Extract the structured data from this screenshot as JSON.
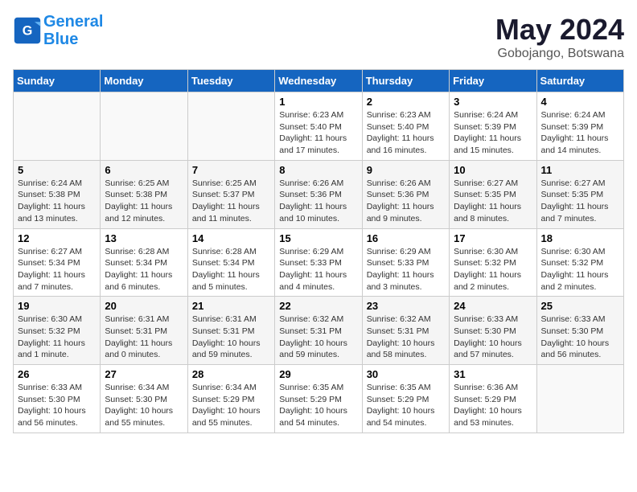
{
  "header": {
    "logo_line1": "General",
    "logo_line2": "Blue",
    "month_title": "May 2024",
    "subtitle": "Gobojango, Botswana"
  },
  "days_of_week": [
    "Sunday",
    "Monday",
    "Tuesday",
    "Wednesday",
    "Thursday",
    "Friday",
    "Saturday"
  ],
  "weeks": [
    [
      {
        "day": "",
        "info": ""
      },
      {
        "day": "",
        "info": ""
      },
      {
        "day": "",
        "info": ""
      },
      {
        "day": "1",
        "info": "Sunrise: 6:23 AM\nSunset: 5:40 PM\nDaylight: 11 hours and 17 minutes."
      },
      {
        "day": "2",
        "info": "Sunrise: 6:23 AM\nSunset: 5:40 PM\nDaylight: 11 hours and 16 minutes."
      },
      {
        "day": "3",
        "info": "Sunrise: 6:24 AM\nSunset: 5:39 PM\nDaylight: 11 hours and 15 minutes."
      },
      {
        "day": "4",
        "info": "Sunrise: 6:24 AM\nSunset: 5:39 PM\nDaylight: 11 hours and 14 minutes."
      }
    ],
    [
      {
        "day": "5",
        "info": "Sunrise: 6:24 AM\nSunset: 5:38 PM\nDaylight: 11 hours and 13 minutes."
      },
      {
        "day": "6",
        "info": "Sunrise: 6:25 AM\nSunset: 5:38 PM\nDaylight: 11 hours and 12 minutes."
      },
      {
        "day": "7",
        "info": "Sunrise: 6:25 AM\nSunset: 5:37 PM\nDaylight: 11 hours and 11 minutes."
      },
      {
        "day": "8",
        "info": "Sunrise: 6:26 AM\nSunset: 5:36 PM\nDaylight: 11 hours and 10 minutes."
      },
      {
        "day": "9",
        "info": "Sunrise: 6:26 AM\nSunset: 5:36 PM\nDaylight: 11 hours and 9 minutes."
      },
      {
        "day": "10",
        "info": "Sunrise: 6:27 AM\nSunset: 5:35 PM\nDaylight: 11 hours and 8 minutes."
      },
      {
        "day": "11",
        "info": "Sunrise: 6:27 AM\nSunset: 5:35 PM\nDaylight: 11 hours and 7 minutes."
      }
    ],
    [
      {
        "day": "12",
        "info": "Sunrise: 6:27 AM\nSunset: 5:34 PM\nDaylight: 11 hours and 7 minutes."
      },
      {
        "day": "13",
        "info": "Sunrise: 6:28 AM\nSunset: 5:34 PM\nDaylight: 11 hours and 6 minutes."
      },
      {
        "day": "14",
        "info": "Sunrise: 6:28 AM\nSunset: 5:34 PM\nDaylight: 11 hours and 5 minutes."
      },
      {
        "day": "15",
        "info": "Sunrise: 6:29 AM\nSunset: 5:33 PM\nDaylight: 11 hours and 4 minutes."
      },
      {
        "day": "16",
        "info": "Sunrise: 6:29 AM\nSunset: 5:33 PM\nDaylight: 11 hours and 3 minutes."
      },
      {
        "day": "17",
        "info": "Sunrise: 6:30 AM\nSunset: 5:32 PM\nDaylight: 11 hours and 2 minutes."
      },
      {
        "day": "18",
        "info": "Sunrise: 6:30 AM\nSunset: 5:32 PM\nDaylight: 11 hours and 2 minutes."
      }
    ],
    [
      {
        "day": "19",
        "info": "Sunrise: 6:30 AM\nSunset: 5:32 PM\nDaylight: 11 hours and 1 minute."
      },
      {
        "day": "20",
        "info": "Sunrise: 6:31 AM\nSunset: 5:31 PM\nDaylight: 11 hours and 0 minutes."
      },
      {
        "day": "21",
        "info": "Sunrise: 6:31 AM\nSunset: 5:31 PM\nDaylight: 10 hours and 59 minutes."
      },
      {
        "day": "22",
        "info": "Sunrise: 6:32 AM\nSunset: 5:31 PM\nDaylight: 10 hours and 59 minutes."
      },
      {
        "day": "23",
        "info": "Sunrise: 6:32 AM\nSunset: 5:31 PM\nDaylight: 10 hours and 58 minutes."
      },
      {
        "day": "24",
        "info": "Sunrise: 6:33 AM\nSunset: 5:30 PM\nDaylight: 10 hours and 57 minutes."
      },
      {
        "day": "25",
        "info": "Sunrise: 6:33 AM\nSunset: 5:30 PM\nDaylight: 10 hours and 56 minutes."
      }
    ],
    [
      {
        "day": "26",
        "info": "Sunrise: 6:33 AM\nSunset: 5:30 PM\nDaylight: 10 hours and 56 minutes."
      },
      {
        "day": "27",
        "info": "Sunrise: 6:34 AM\nSunset: 5:30 PM\nDaylight: 10 hours and 55 minutes."
      },
      {
        "day": "28",
        "info": "Sunrise: 6:34 AM\nSunset: 5:29 PM\nDaylight: 10 hours and 55 minutes."
      },
      {
        "day": "29",
        "info": "Sunrise: 6:35 AM\nSunset: 5:29 PM\nDaylight: 10 hours and 54 minutes."
      },
      {
        "day": "30",
        "info": "Sunrise: 6:35 AM\nSunset: 5:29 PM\nDaylight: 10 hours and 54 minutes."
      },
      {
        "day": "31",
        "info": "Sunrise: 6:36 AM\nSunset: 5:29 PM\nDaylight: 10 hours and 53 minutes."
      },
      {
        "day": "",
        "info": ""
      }
    ]
  ]
}
